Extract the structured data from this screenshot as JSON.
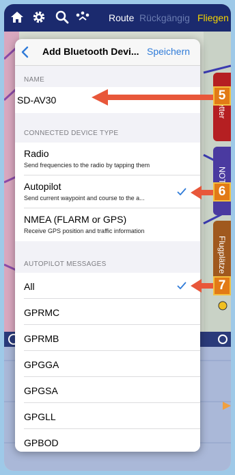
{
  "toolbar": {
    "route_label": "Route",
    "undo_label": "Rückgängig",
    "fly_label": "Fliegen"
  },
  "side_tabs": {
    "tab1": "Wetter",
    "tab2": "NOTAM",
    "tab3": "Flugplätze"
  },
  "nav": {
    "back_icon": "chevron-left-icon",
    "title": "Add Bluetooth Devi...",
    "save_label": "Speichern"
  },
  "name_section": {
    "header": "NAME",
    "value": "SD-AV30"
  },
  "device_type_section": {
    "header": "CONNECTED DEVICE TYPE",
    "items": [
      {
        "title": "Radio",
        "subtitle": "Send frequencies to the radio by tapping them",
        "selected": false
      },
      {
        "title": "Autopilot",
        "subtitle": "Send current waypoint and course to the a...",
        "selected": true
      },
      {
        "title": "NMEA (FLARM or GPS)",
        "subtitle": "Receive GPS position and traffic information",
        "selected": false
      }
    ]
  },
  "autopilot_section": {
    "header": "AUTOPILOT MESSAGES",
    "items": [
      {
        "label": "All",
        "selected": true
      },
      {
        "label": "GPRMC",
        "selected": false
      },
      {
        "label": "GPRMB",
        "selected": false
      },
      {
        "label": "GPGGA",
        "selected": false
      },
      {
        "label": "GPGSA",
        "selected": false
      },
      {
        "label": "GPGLL",
        "selected": false
      },
      {
        "label": "GPBOD",
        "selected": false
      }
    ]
  },
  "callouts": {
    "c5": "5",
    "c6": "6",
    "c7": "7"
  },
  "colors": {
    "accent": "#2f7bd8",
    "toolbar": "#1b2a6e",
    "callout": "#e27a16",
    "arrow": "#e8573a",
    "fly": "#f5d400"
  }
}
